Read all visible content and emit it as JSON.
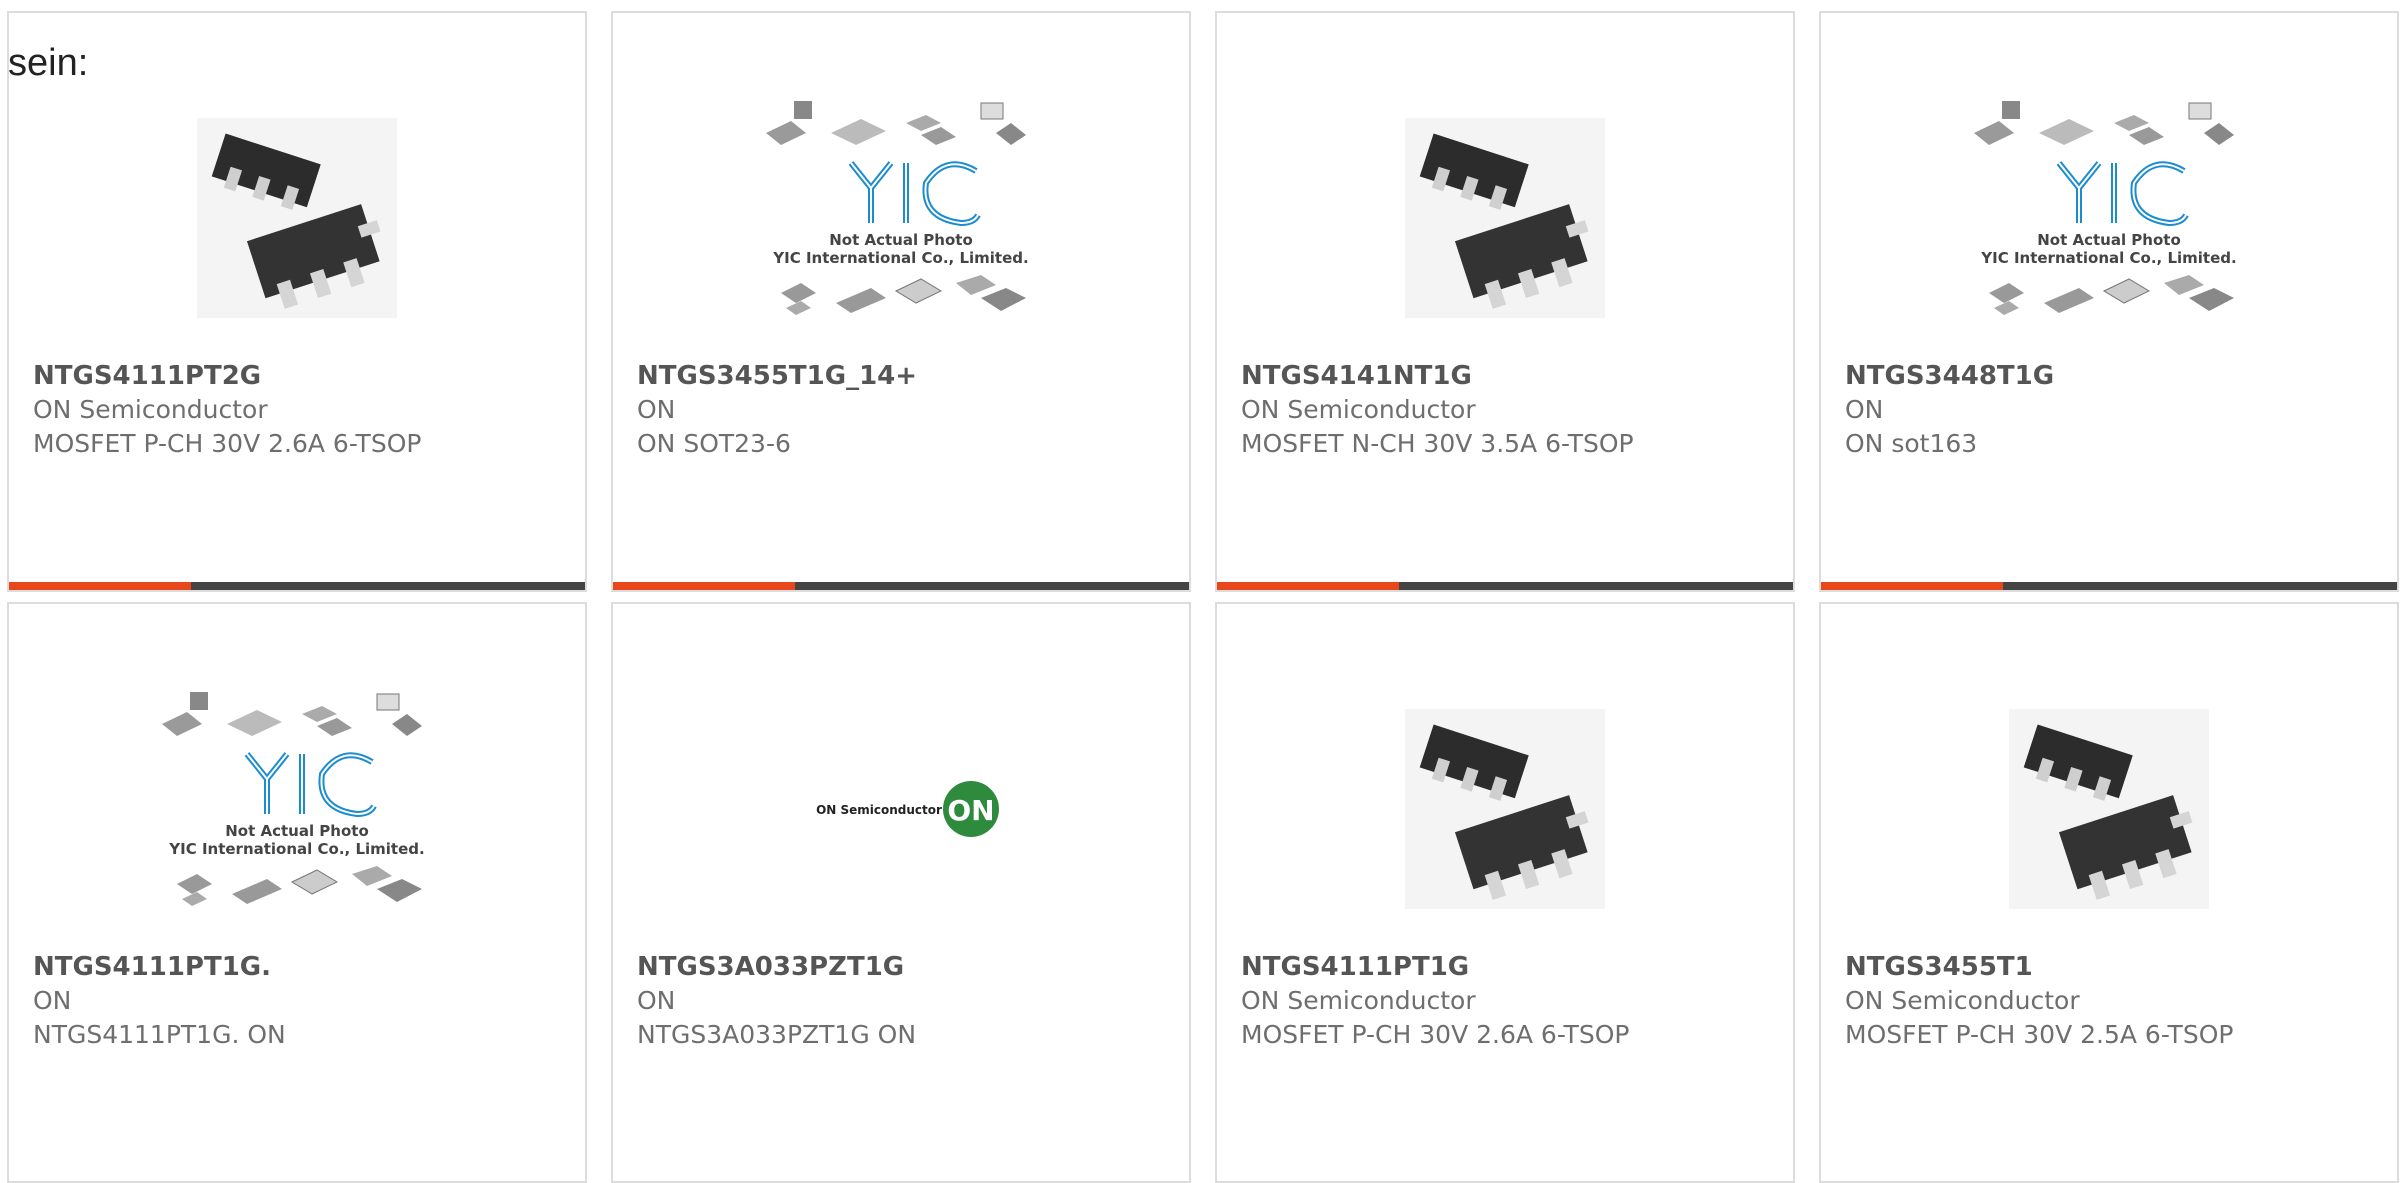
{
  "intro": "sein:",
  "products": [
    {
      "part": "NTGS4111PT2G",
      "maker": "ON Semiconductor",
      "desc": "MOSFET P-CH 30V 2.6A 6-TSOP",
      "image": "chip-photo"
    },
    {
      "part": "NTGS3455T1G_14+",
      "maker": "ON",
      "desc": "ON SOT23-6",
      "image": "placeholder"
    },
    {
      "part": "NTGS4141NT1G",
      "maker": "ON Semiconductor",
      "desc": "MOSFET N-CH 30V 3.5A 6-TSOP",
      "image": "chip-photo"
    },
    {
      "part": "NTGS3448T1G",
      "maker": "ON",
      "desc": "ON sot163",
      "image": "placeholder"
    },
    {
      "part": "NTGS4111PT1G.",
      "maker": "ON",
      "desc": "NTGS4111PT1G. ON",
      "image": "placeholder"
    },
    {
      "part": "NTGS3A033PZT1G",
      "maker": "ON",
      "desc": "NTGS3A033PZT1G ON",
      "image": "on-logo"
    },
    {
      "part": "NTGS4111PT1G",
      "maker": "ON Semiconductor",
      "desc": "MOSFET P-CH 30V 2.6A 6-TSOP",
      "image": "chip-photo"
    },
    {
      "part": "NTGS3455T1",
      "maker": "ON Semiconductor",
      "desc": "MOSFET P-CH 30V 2.5A 6-TSOP",
      "image": "chip-photo"
    }
  ],
  "placeholder": {
    "logo": "YIC",
    "line1": "Not Actual Photo",
    "line2": "YIC International Co., Limited."
  },
  "on_logo": {
    "wordmark": "ON Semiconductor",
    "mark": "ON"
  },
  "colors": {
    "accent": "#e8471c",
    "bar": "#444444",
    "border": "#dcdcdc",
    "yic_blue": "#1a8ccf",
    "on_green": "#2e8b3e"
  }
}
